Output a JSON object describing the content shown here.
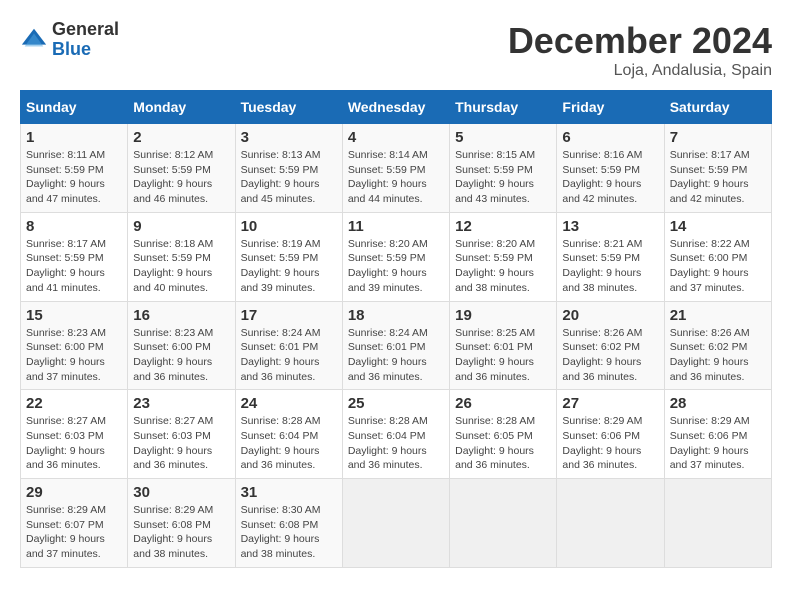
{
  "header": {
    "logo_general": "General",
    "logo_blue": "Blue",
    "title": "December 2024",
    "subtitle": "Loja, Andalusia, Spain"
  },
  "days_of_week": [
    "Sunday",
    "Monday",
    "Tuesday",
    "Wednesday",
    "Thursday",
    "Friday",
    "Saturday"
  ],
  "weeks": [
    [
      {
        "day": "1",
        "sunrise": "8:11 AM",
        "sunset": "5:59 PM",
        "daylight": "9 hours and 47 minutes."
      },
      {
        "day": "2",
        "sunrise": "8:12 AM",
        "sunset": "5:59 PM",
        "daylight": "9 hours and 46 minutes."
      },
      {
        "day": "3",
        "sunrise": "8:13 AM",
        "sunset": "5:59 PM",
        "daylight": "9 hours and 45 minutes."
      },
      {
        "day": "4",
        "sunrise": "8:14 AM",
        "sunset": "5:59 PM",
        "daylight": "9 hours and 44 minutes."
      },
      {
        "day": "5",
        "sunrise": "8:15 AM",
        "sunset": "5:59 PM",
        "daylight": "9 hours and 43 minutes."
      },
      {
        "day": "6",
        "sunrise": "8:16 AM",
        "sunset": "5:59 PM",
        "daylight": "9 hours and 42 minutes."
      },
      {
        "day": "7",
        "sunrise": "8:17 AM",
        "sunset": "5:59 PM",
        "daylight": "9 hours and 42 minutes."
      }
    ],
    [
      {
        "day": "8",
        "sunrise": "8:17 AM",
        "sunset": "5:59 PM",
        "daylight": "9 hours and 41 minutes."
      },
      {
        "day": "9",
        "sunrise": "8:18 AM",
        "sunset": "5:59 PM",
        "daylight": "9 hours and 40 minutes."
      },
      {
        "day": "10",
        "sunrise": "8:19 AM",
        "sunset": "5:59 PM",
        "daylight": "9 hours and 39 minutes."
      },
      {
        "day": "11",
        "sunrise": "8:20 AM",
        "sunset": "5:59 PM",
        "daylight": "9 hours and 39 minutes."
      },
      {
        "day": "12",
        "sunrise": "8:20 AM",
        "sunset": "5:59 PM",
        "daylight": "9 hours and 38 minutes."
      },
      {
        "day": "13",
        "sunrise": "8:21 AM",
        "sunset": "5:59 PM",
        "daylight": "9 hours and 38 minutes."
      },
      {
        "day": "14",
        "sunrise": "8:22 AM",
        "sunset": "6:00 PM",
        "daylight": "9 hours and 37 minutes."
      }
    ],
    [
      {
        "day": "15",
        "sunrise": "8:23 AM",
        "sunset": "6:00 PM",
        "daylight": "9 hours and 37 minutes."
      },
      {
        "day": "16",
        "sunrise": "8:23 AM",
        "sunset": "6:00 PM",
        "daylight": "9 hours and 36 minutes."
      },
      {
        "day": "17",
        "sunrise": "8:24 AM",
        "sunset": "6:01 PM",
        "daylight": "9 hours and 36 minutes."
      },
      {
        "day": "18",
        "sunrise": "8:24 AM",
        "sunset": "6:01 PM",
        "daylight": "9 hours and 36 minutes."
      },
      {
        "day": "19",
        "sunrise": "8:25 AM",
        "sunset": "6:01 PM",
        "daylight": "9 hours and 36 minutes."
      },
      {
        "day": "20",
        "sunrise": "8:26 AM",
        "sunset": "6:02 PM",
        "daylight": "9 hours and 36 minutes."
      },
      {
        "day": "21",
        "sunrise": "8:26 AM",
        "sunset": "6:02 PM",
        "daylight": "9 hours and 36 minutes."
      }
    ],
    [
      {
        "day": "22",
        "sunrise": "8:27 AM",
        "sunset": "6:03 PM",
        "daylight": "9 hours and 36 minutes."
      },
      {
        "day": "23",
        "sunrise": "8:27 AM",
        "sunset": "6:03 PM",
        "daylight": "9 hours and 36 minutes."
      },
      {
        "day": "24",
        "sunrise": "8:28 AM",
        "sunset": "6:04 PM",
        "daylight": "9 hours and 36 minutes."
      },
      {
        "day": "25",
        "sunrise": "8:28 AM",
        "sunset": "6:04 PM",
        "daylight": "9 hours and 36 minutes."
      },
      {
        "day": "26",
        "sunrise": "8:28 AM",
        "sunset": "6:05 PM",
        "daylight": "9 hours and 36 minutes."
      },
      {
        "day": "27",
        "sunrise": "8:29 AM",
        "sunset": "6:06 PM",
        "daylight": "9 hours and 36 minutes."
      },
      {
        "day": "28",
        "sunrise": "8:29 AM",
        "sunset": "6:06 PM",
        "daylight": "9 hours and 37 minutes."
      }
    ],
    [
      {
        "day": "29",
        "sunrise": "8:29 AM",
        "sunset": "6:07 PM",
        "daylight": "9 hours and 37 minutes."
      },
      {
        "day": "30",
        "sunrise": "8:29 AM",
        "sunset": "6:08 PM",
        "daylight": "9 hours and 38 minutes."
      },
      {
        "day": "31",
        "sunrise": "8:30 AM",
        "sunset": "6:08 PM",
        "daylight": "9 hours and 38 minutes."
      },
      null,
      null,
      null,
      null
    ]
  ],
  "labels": {
    "sunrise": "Sunrise:",
    "sunset": "Sunset:",
    "daylight": "Daylight:"
  }
}
